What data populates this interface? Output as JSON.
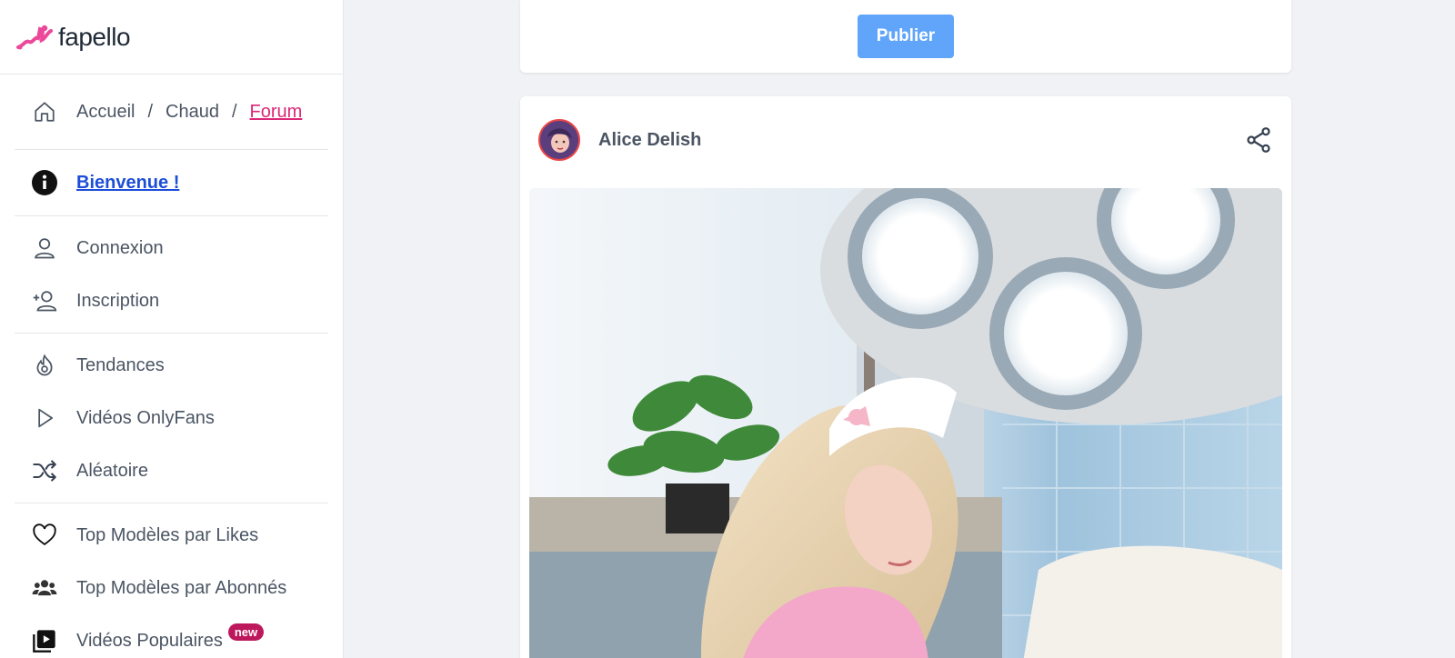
{
  "brand": {
    "name": "fapello",
    "accent": "#db2777"
  },
  "breadcrumb": {
    "items": [
      "Accueil",
      "Chaud",
      "Forum"
    ],
    "separator": "/"
  },
  "sidebar": {
    "welcome": "Bienvenue !",
    "auth": [
      {
        "label": "Connexion",
        "icon": "user-icon"
      },
      {
        "label": "Inscription",
        "icon": "user-plus-icon"
      }
    ],
    "explore": [
      {
        "label": "Tendances",
        "icon": "fire-icon"
      },
      {
        "label": "Vidéos OnlyFans",
        "icon": "play-icon"
      },
      {
        "label": "Aléatoire",
        "icon": "shuffle-icon"
      }
    ],
    "tops": [
      {
        "label": "Top Modèles par Likes",
        "icon": "heart-icon"
      },
      {
        "label": "Top Modèles par Abonnés",
        "icon": "users-icon"
      },
      {
        "label": "Vidéos Populaires",
        "icon": "video-icon",
        "badge": "new"
      }
    ]
  },
  "composer": {
    "publish_label": "Publier"
  },
  "post": {
    "author": "Alice Delish",
    "share_icon": "share-icon"
  }
}
